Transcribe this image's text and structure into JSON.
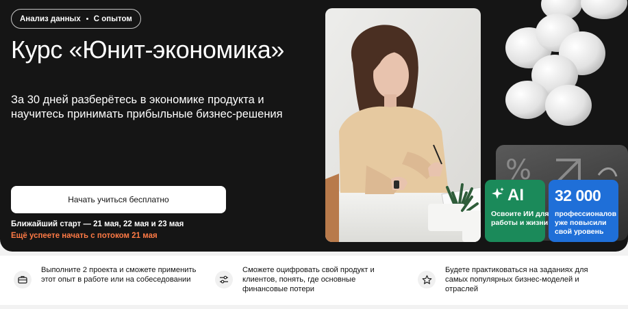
{
  "hero": {
    "tags": [
      "Анализ данных",
      "С опытом"
    ],
    "title": "Курс «Юнит-экономика»",
    "subtitle": "За 30 дней разберётесь в экономике продукта и научитесь принимать прибыльные бизнес-решения",
    "cta_label": "Начать учиться бесплатно",
    "start_text": "Ближайший старт — 21 мая, 22 мая и 23 мая",
    "start_hint": "Ещё успеете начать с потоком 21 мая"
  },
  "cards": {
    "ai": {
      "title": "AI",
      "text": "Освоите ИИ для работы и жизни",
      "icon": "sparkle-icon",
      "color": "#1b8a5a"
    },
    "stat": {
      "value": "32 000",
      "text": "профессионалов уже повысили свой уровень",
      "color": "#1f6fd8"
    }
  },
  "features": [
    {
      "icon": "briefcase-icon",
      "text": "Выполните 2 проекта и сможете применить этот опыт в работе или на собеседовании"
    },
    {
      "icon": "sliders-icon",
      "text": "Сможете оцифровать свой продукт и клиентов, понять, где основные финансовые потери"
    },
    {
      "icon": "star-icon",
      "text": "Будете практиковаться на заданиях для самых популярных бизнес-моделей и отраслей"
    }
  ],
  "colors": {
    "hero_bg": "#151515",
    "accent_orange": "#ff7a45"
  }
}
